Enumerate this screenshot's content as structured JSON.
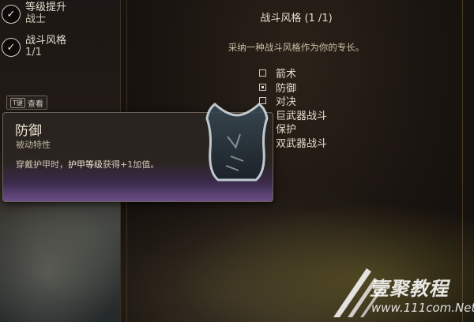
{
  "progress_steps": [
    {
      "title": "等级提升",
      "subtitle": "战士"
    },
    {
      "title": "战斗风格",
      "subtitle": "1/1"
    }
  ],
  "inspect_hint": {
    "key": "T键",
    "label": "查看"
  },
  "header": {
    "title": "战斗风格 (1 /1)",
    "subtitle": "采纳一种战斗风格作为你的专长。"
  },
  "options": [
    {
      "label": "箭术",
      "selected": false
    },
    {
      "label": "防御",
      "selected": true
    },
    {
      "label": "对决",
      "selected": false
    },
    {
      "label": "巨武器战斗",
      "selected": false
    },
    {
      "label": "保护",
      "selected": false
    },
    {
      "label": "双武器战斗",
      "selected": false
    }
  ],
  "tooltip": {
    "title": "防御",
    "type": "被动特性",
    "desc_prefix": "穿戴护甲时，",
    "desc_highlight": "护甲等级",
    "desc_suffix": "获得+1加值。"
  },
  "watermark": {
    "title": "壹聚教程",
    "url": "www.111com.Net"
  },
  "colors": {
    "tooltip_gradient_bottom": "#6a4e86",
    "text": "#e6dccb"
  }
}
